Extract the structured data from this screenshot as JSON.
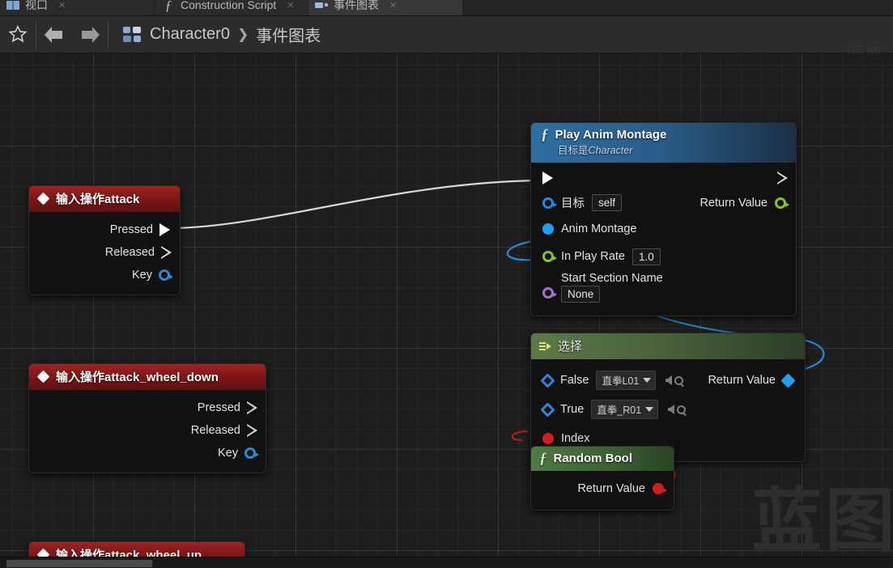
{
  "window": {
    "zoom_label": "缩放",
    "watermark": "蓝图"
  },
  "tabs": [
    {
      "label": "视口",
      "icon": "viewport-icon",
      "active": false,
      "close": "✕"
    },
    {
      "label": "Construction Script",
      "icon": "function-icon",
      "active": false,
      "close": "✕"
    },
    {
      "label": "事件图表",
      "icon": "graph-icon",
      "active": true,
      "close": "✕"
    }
  ],
  "toolbar": {
    "favorite_icon": "star-icon",
    "back_icon": "back-arrow-icon",
    "forward_icon": "forward-arrow-icon",
    "blueprint_icon": "blueprint-icon",
    "breadcrumb_root": "Character0",
    "breadcrumb_separator": "❯",
    "breadcrumb_leaf": "事件图表"
  },
  "nodes": {
    "input_attack": {
      "title": "输入操作attack",
      "pins": [
        {
          "label": "Pressed",
          "type": "exec",
          "state": "filled"
        },
        {
          "label": "Released",
          "type": "exec",
          "state": "hollow"
        },
        {
          "label": "Key",
          "type": "struct",
          "state": "blue"
        }
      ]
    },
    "input_attack_wheel_down": {
      "title": "输入操作attack_wheel_down",
      "pins": [
        {
          "label": "Pressed",
          "type": "exec",
          "state": "hollow"
        },
        {
          "label": "Released",
          "type": "exec",
          "state": "hollow"
        },
        {
          "label": "Key",
          "type": "struct",
          "state": "blue"
        }
      ]
    },
    "input_attack_wheel_up": {
      "title": "输入操作attack_wheel_up"
    },
    "play_anim_montage": {
      "title": "Play Anim Montage",
      "subtitle_prefix": "目标是",
      "subtitle_target": "Character",
      "inputs": [
        {
          "label": "目标",
          "value": "self",
          "pin": "object-blue"
        },
        {
          "label": "Anim Montage",
          "value": "",
          "pin": "object-blue-filled"
        },
        {
          "label": "In Play Rate",
          "value": "1.0",
          "pin": "float-green"
        },
        {
          "label": "Start Section Name",
          "value": "None",
          "pin": "name-purple"
        }
      ],
      "outputs": [
        {
          "label": "Return Value",
          "pin": "float-green"
        }
      ]
    },
    "select": {
      "title": "选择",
      "inputs": [
        {
          "label": "False",
          "value": "直拳L01",
          "pin": "wildcard-blue"
        },
        {
          "label": "True",
          "value": "直拳_R01",
          "pin": "wildcard-blue"
        },
        {
          "label": "Index",
          "value": "",
          "pin": "bool-red"
        }
      ],
      "outputs": [
        {
          "label": "Return Value",
          "pin": "wildcard-blue"
        }
      ]
    },
    "random_bool": {
      "title": "Random Bool",
      "outputs": [
        {
          "label": "Return Value",
          "pin": "bool-red"
        }
      ]
    }
  },
  "colors": {
    "exec_white": "#ffffff",
    "object_blue": "#2e86d8",
    "float_green": "#86c232",
    "name_purple": "#a86fd0",
    "bool_red": "#cf2020",
    "wildcard_blue": "#1f9ff0",
    "canvas_bg": "#1e1e1e",
    "event_red": "#9e2222",
    "function_blue": "#2e6ea3",
    "pure_green": "#4e7a43"
  }
}
